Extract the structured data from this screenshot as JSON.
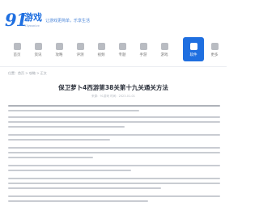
{
  "header": {
    "logo_mark": "91",
    "logo_word": "游戏",
    "logo_sub": "91youxi.cc",
    "tagline": "让游戏更简单，乐享生活"
  },
  "nav": {
    "items": [
      {
        "label": "首页",
        "icon": "home-icon"
      },
      {
        "label": "资讯",
        "icon": "news-icon"
      },
      {
        "label": "攻略",
        "icon": "guide-icon"
      },
      {
        "label": "评测",
        "icon": "review-icon"
      },
      {
        "label": "视频",
        "icon": "video-icon"
      },
      {
        "label": "专题",
        "icon": "topic-icon"
      },
      {
        "label": "手游",
        "icon": "mobile-game-icon"
      },
      {
        "label": "游戏",
        "icon": "game-icon"
      },
      {
        "label": "软件",
        "icon": "app-icon"
      },
      {
        "label": "更多",
        "icon": "more-icon"
      }
    ],
    "active_index": 8,
    "active_color": "#1f6fe0"
  },
  "breadcrumb": "位置：首页 > 攻略 > 正文",
  "article": {
    "title": "保卫萝卜4西游第38关第十九关通关方法",
    "meta": "来源：91游戏  时间：2023-01-01"
  }
}
